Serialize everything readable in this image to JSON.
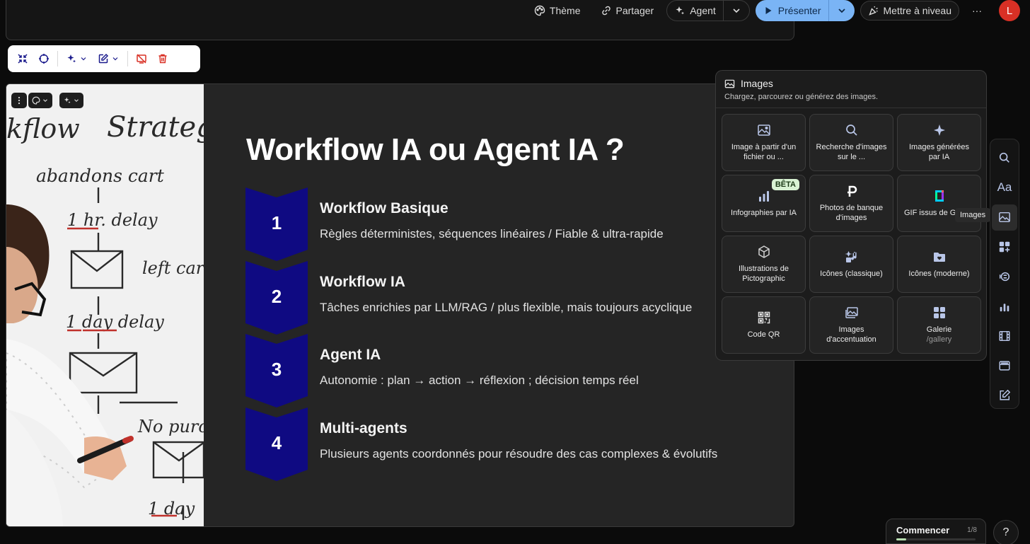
{
  "topbar": {
    "theme_label": "Thème",
    "share_label": "Partager",
    "agent_label": "Agent",
    "present_label": "Présenter",
    "upgrade_label": "Mettre à niveau",
    "more_label": "···",
    "avatar_initial": "L"
  },
  "slide": {
    "title": "Workflow IA ou Agent IA ?",
    "steps": [
      {
        "number": "1",
        "title": "Workflow Basique",
        "description": "Règles déterministes, séquences linéaires / Fiable & ultra-rapide"
      },
      {
        "number": "2",
        "title": "Workflow IA",
        "description": "Tâches enrichies par LLM/RAG / plus flexible, mais toujours acyclique"
      },
      {
        "number": "3",
        "title": "Agent IA",
        "description": "Autonomie : plan → action → réflexion ; décision temps réel"
      },
      {
        "number": "4",
        "title": "Multi-agents",
        "description": "Plusieurs agents coordonnés pour résoudre des cas complexes & évolutifs"
      }
    ],
    "chevron_color": "#0f0a82"
  },
  "whiteboard": {
    "lines": [
      "kflow",
      "Strateg",
      "abandons cart",
      "1 hr. delay",
      "left cart",
      "1 day delay",
      "No purch",
      "1 day"
    ]
  },
  "images_panel": {
    "title": "Images",
    "subtitle": "Chargez, parcourez ou générez des images.",
    "tiles": [
      {
        "label": "Image à partir d'un fichier ou ...",
        "icon": "image-icon"
      },
      {
        "label": "Recherche d'images sur le ...",
        "icon": "search-icon"
      },
      {
        "label": "Images générées par IA",
        "icon": "sparkle-icon"
      },
      {
        "label": "Infographies par IA",
        "icon": "bar-chart-icon",
        "badge": "BÊTA"
      },
      {
        "label": "Photos de banque d'images",
        "icon": "pexels-icon"
      },
      {
        "label": "GIF issus de GIPHY",
        "icon": "giphy-icon"
      },
      {
        "label": "Illustrations de Pictographic",
        "icon": "cube-icon"
      },
      {
        "label": "Icônes (classique)",
        "icon": "icons-classic-icon"
      },
      {
        "label": "Icônes (moderne)",
        "icon": "folder-heart-icon"
      },
      {
        "label": "Code QR",
        "icon": "qr-code-icon"
      },
      {
        "label": "Images d'accentuation",
        "icon": "accent-image-icon"
      },
      {
        "label": "Galerie",
        "sublabel": "/gallery",
        "icon": "gallery-icon"
      }
    ]
  },
  "right_rail": {
    "tooltip": "Images",
    "text_icon_label": "Aa"
  },
  "bottom": {
    "start_label": "Commencer",
    "progress_text": "1/8",
    "progress_fraction": 0.125,
    "help_label": "?"
  },
  "colors": {
    "present_button": "#7ab4f5",
    "avatar": "#d93025",
    "delete_icon": "#d93025",
    "beta_badge": "#d9f3d4"
  }
}
